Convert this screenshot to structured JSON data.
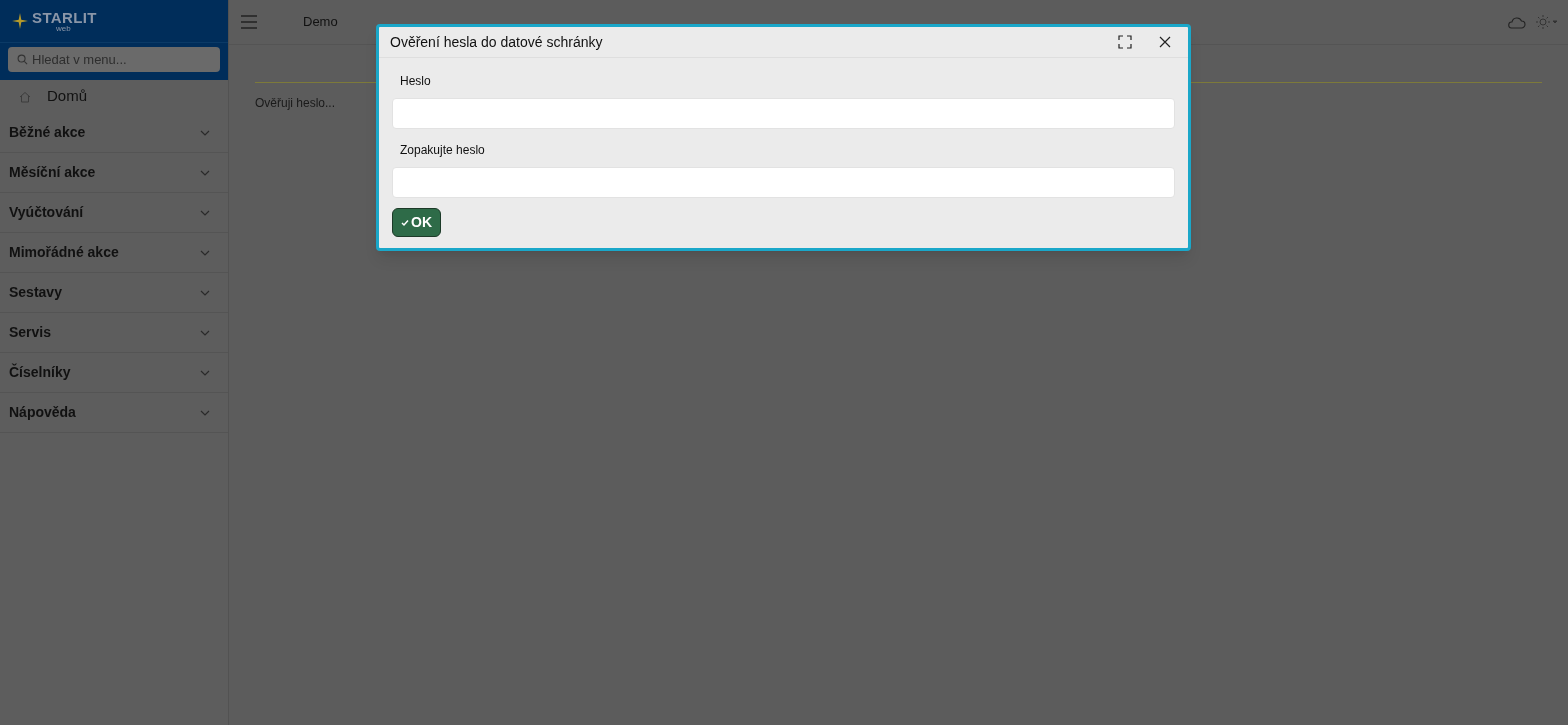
{
  "logo": {
    "name": "STARLIT",
    "sub": "web"
  },
  "sidebar": {
    "search": {
      "placeholder": "Hledat v menu..."
    },
    "home": "Domů",
    "sections": [
      {
        "label": "Běžné akce",
        "expanded": false
      },
      {
        "label": "Měsíční akce",
        "expanded": false
      },
      {
        "label": "Vyúčtování",
        "expanded": false
      },
      {
        "label": "Mimořádné akce",
        "expanded": false
      },
      {
        "label": "Sestavy",
        "expanded": false
      },
      {
        "label": "Servis",
        "expanded": false
      },
      {
        "label": "Číselníky",
        "expanded": false
      },
      {
        "label": "Nápověda",
        "expanded": false
      }
    ]
  },
  "header": {
    "title": "Demo"
  },
  "main": {
    "status": "Ověřuji heslo..."
  },
  "dialog": {
    "title": "Ověření hesla do datové schránky",
    "fields": [
      {
        "label": "Heslo"
      },
      {
        "label": "Zopakujte heslo"
      }
    ],
    "ok_button": "OK"
  }
}
